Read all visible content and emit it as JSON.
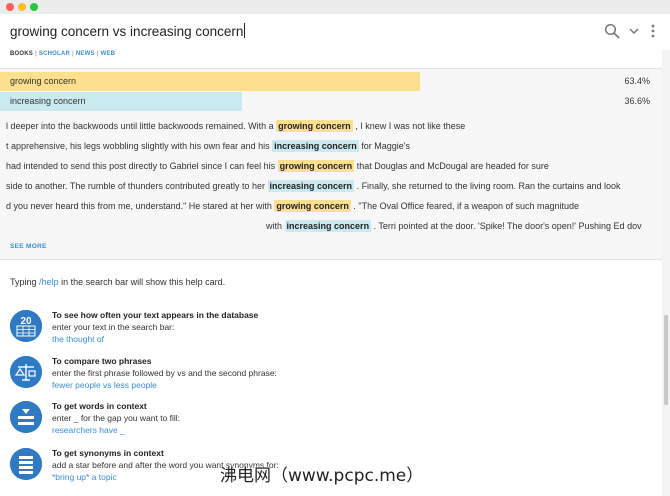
{
  "search": {
    "query": "growing concern vs increasing concern"
  },
  "source_tabs": [
    "BOOKS",
    "SCHOLAR",
    "NEWS",
    "WEB"
  ],
  "results": {
    "bars": [
      {
        "label": "growing concern",
        "percent_text": "63.4%",
        "fraction": 0.634,
        "color": "#fce08d"
      },
      {
        "label": "increasing concern",
        "percent_text": "36.6%",
        "fraction": 0.366,
        "color": "#cbe9f1"
      }
    ],
    "snippets": [
      {
        "before": "l deeper into the backwoods until little backwoods remained. With a",
        "match": "growing concern",
        "after": ", I knew I was not like these"
      },
      {
        "before": "t apprehensive, his legs wobbling slightly with his own fear and his",
        "match": "increasing concern",
        "after": "for Maggie's"
      },
      {
        "before": "had intended to send this post directly to Gabriel since I can feel his",
        "match": "growing concern",
        "after": "that Douglas and McDougal are headed for sure"
      },
      {
        "before": "side to another. The rumble of thunders contributed greatly to her",
        "match": "increasing concern",
        "after": ". Finally, she returned to the living room. Ran the curtains and look"
      },
      {
        "before": "d you never heard this from me, understand.\" He stared at her with",
        "match": "growing concern",
        "after": ". \"The Oval Office feared, if a weapon of such magnitude"
      },
      {
        "before": "with",
        "match": "increasing concern",
        "after": ". Terri pointed at the door. 'Spike! The door's open!' Pushing Ed dov"
      }
    ],
    "see_more": "SEE MORE"
  },
  "help": {
    "intro_before": "Typing",
    "intro_cmd": "/help",
    "intro_after": "in the search bar will show this help card.",
    "items": [
      {
        "icon": "frequency-20-icon",
        "icon_text": "20",
        "title": "To see how often your text appears in the database",
        "desc": "enter your text in the search bar:",
        "example": "the thought of"
      },
      {
        "icon": "compare-scale-icon",
        "title": "To compare two phrases",
        "desc": "enter the first phrase followed by vs and the second phrase:",
        "example": "fewer people vs less people"
      },
      {
        "icon": "context-blank-icon",
        "title": "To get words in context",
        "desc": "enter _ for the gap you want to fill:",
        "example": "researchers have _"
      },
      {
        "icon": "synonyms-list-icon",
        "title": "To get synonyms in context",
        "desc": "add a star before and after the word you want synonyms for:",
        "example": "*bring up* a topic"
      }
    ]
  },
  "watermark": "沸电网（www.pcpc.me）"
}
